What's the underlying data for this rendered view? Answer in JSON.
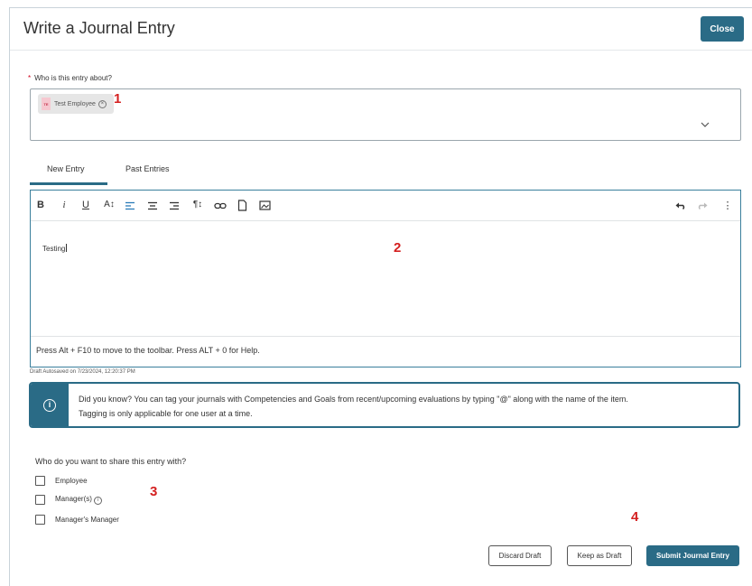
{
  "dialog": {
    "title": "Write a Journal Entry",
    "close_label": "Close"
  },
  "who": {
    "required_mark": "*",
    "label": "Who is this entry about?",
    "chip_initials": "TE",
    "chip_name": "Test Employee",
    "chip_remove": "×"
  },
  "annotations": [
    "1",
    "2",
    "3",
    "4"
  ],
  "tabs": [
    {
      "label": "New Entry",
      "active": true
    },
    {
      "label": "Past Entries",
      "active": false
    }
  ],
  "editor": {
    "toolbar": [
      {
        "icon": "bold-icon",
        "glyph": "B"
      },
      {
        "icon": "italic-icon",
        "glyph": "i"
      },
      {
        "icon": "underline-icon",
        "glyph": "U"
      },
      {
        "icon": "font-size-icon",
        "glyph": "A↕"
      },
      {
        "icon": "align-left-icon",
        "glyph": ""
      },
      {
        "icon": "align-center-icon",
        "glyph": ""
      },
      {
        "icon": "align-right-icon",
        "glyph": ""
      },
      {
        "icon": "paragraph-icon",
        "glyph": "¶↕"
      },
      {
        "icon": "link-icon",
        "glyph": ""
      },
      {
        "icon": "document-icon",
        "glyph": ""
      },
      {
        "icon": "image-icon",
        "glyph": ""
      },
      {
        "icon": "undo-icon",
        "glyph": ""
      },
      {
        "icon": "redo-icon",
        "glyph": ""
      },
      {
        "icon": "more-icon",
        "glyph": "⋮"
      }
    ],
    "content": "Testing",
    "help": "Press Alt + F10 to move to the toolbar. Press ALT + 0 for Help."
  },
  "autosave": "Draft Autosaved on 7/23/2024, 12:20:37 PM",
  "info": {
    "icon_glyph": "i",
    "line1": "Did you know? You can tag your journals with Competencies and Goals from recent/upcoming evaluations by typing \"@\" along with the name of the item.",
    "line2": "Tagging is only applicable for one user at a time."
  },
  "share": {
    "question": "Who do you want to share this entry with?",
    "options": [
      {
        "label": "Employee",
        "checked": false
      },
      {
        "label": "Manager(s)",
        "checked": false
      },
      {
        "label": "Manager's Manager",
        "checked": false
      }
    ],
    "info_glyph": "i"
  },
  "actions": {
    "discard": "Discard Draft",
    "keep": "Keep as Draft",
    "submit": "Submit Journal Entry"
  },
  "colors": {
    "primary": "#2a6b86",
    "annotation": "#d42020",
    "required": "#d0021b",
    "active_tool": "#2a7bb8"
  }
}
